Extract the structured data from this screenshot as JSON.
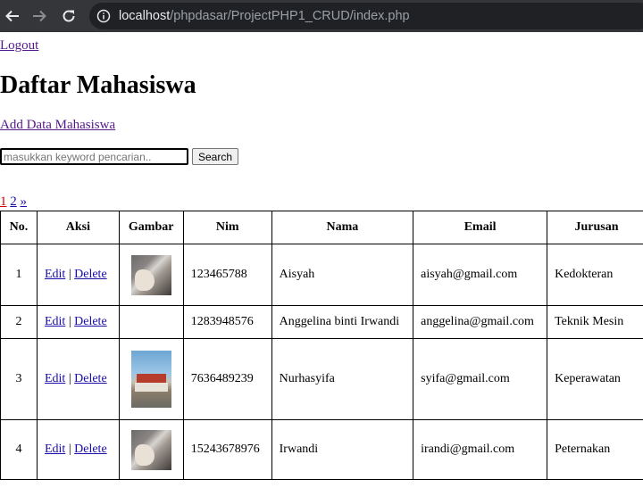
{
  "browser": {
    "url_host": "localhost",
    "url_path": "/phpdasar/ProjectPHP1_CRUD/index.php"
  },
  "page": {
    "logout_label": "Logout",
    "title": "Daftar Mahasiswa",
    "add_link_label": "Add Data Mahasiswa",
    "search": {
      "placeholder": "masukkan keyword pencarian..",
      "button_label": "Search"
    },
    "pagination": {
      "current": "1",
      "next_page": "2",
      "next_arrow": "»"
    }
  },
  "table": {
    "headers": [
      "No.",
      "Aksi",
      "Gambar",
      "Nim",
      "Nama",
      "Email",
      "Jurusan"
    ],
    "edit_label": "Edit",
    "delete_label": "Delete",
    "separator": "|",
    "rows": [
      {
        "no": "1",
        "nim": "123465788",
        "nama": "Aisyah",
        "email": "aisyah@gmail.com",
        "jurusan": "Kedokteran",
        "image": "photo-person"
      },
      {
        "no": "2",
        "nim": "1283948576",
        "nama": "Anggelina binti Irwandi",
        "email": "anggelina@gmail.com",
        "jurusan": "Teknik Mesin",
        "image": ""
      },
      {
        "no": "3",
        "nim": "7636489239",
        "nama": "Nurhasyifa",
        "email": "syifa@gmail.com",
        "jurusan": "Keperawatan",
        "image": "photo-building"
      },
      {
        "no": "4",
        "nim": "15243678976",
        "nama": "Irwandi",
        "email": "irandi@gmail.com",
        "jurusan": "Peternakan",
        "image": "photo-person"
      }
    ]
  }
}
